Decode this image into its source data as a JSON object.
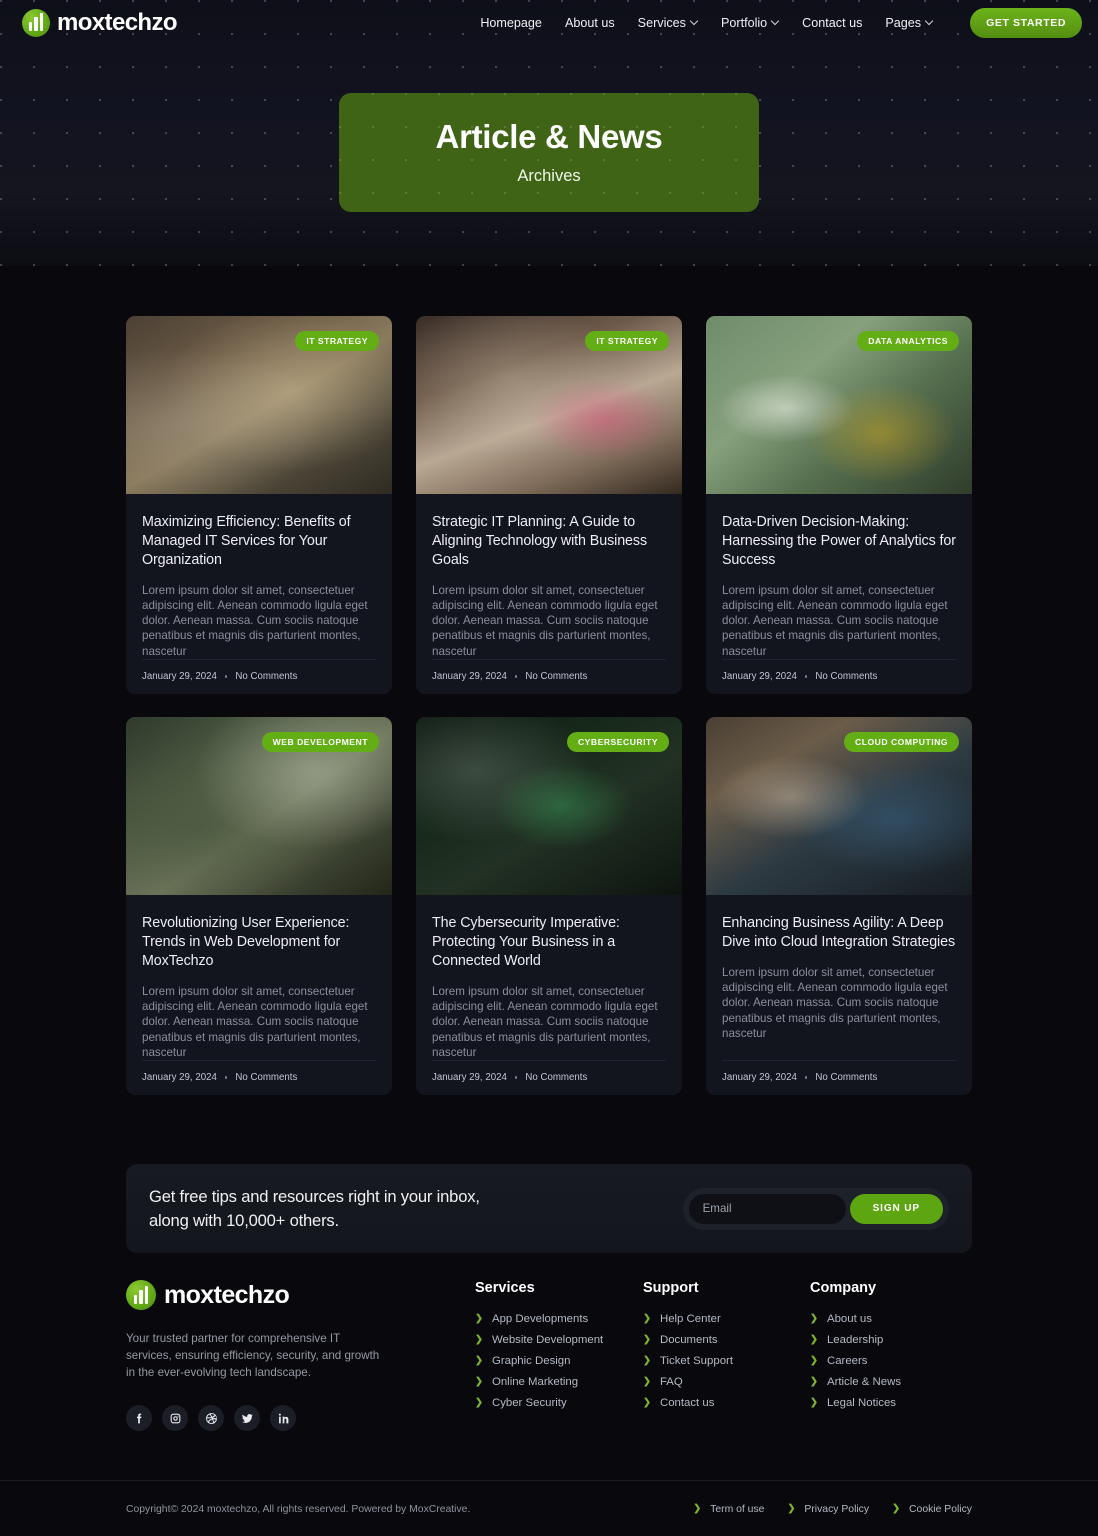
{
  "brand": {
    "name": "moxtechzo",
    "logo_icon": "bars-circle-logo-icon"
  },
  "nav": {
    "items": [
      {
        "label": "Homepage",
        "has_dropdown": false
      },
      {
        "label": "About us",
        "has_dropdown": false
      },
      {
        "label": "Services",
        "has_dropdown": true
      },
      {
        "label": "Portfolio",
        "has_dropdown": true
      },
      {
        "label": "Contact us",
        "has_dropdown": false
      },
      {
        "label": "Pages",
        "has_dropdown": true
      }
    ],
    "cta_label": "GET STARTED"
  },
  "hero": {
    "title": "Article & News",
    "subtitle": "Archives",
    "bg_color": "#3f6415"
  },
  "posts": [
    {
      "badge": "IT STRATEGY",
      "title": "Maximizing Efficiency: Benefits of Managed IT Services for Your Organization",
      "excerpt": "Lorem ipsum dolor sit amet, consectetuer adipiscing elit. Aenean commodo ligula eget dolor. Aenean massa. Cum sociis natoque penatibus et magnis dis parturient montes, nascetur",
      "date": "January 29, 2024",
      "comments": "No Comments",
      "image": "office-team-collaboration"
    },
    {
      "badge": "IT STRATEGY",
      "title": "Strategic IT Planning: A Guide to Aligning Technology with Business Goals",
      "excerpt": "Lorem ipsum dolor sit amet, consectetuer adipiscing elit. Aenean commodo ligula eget dolor. Aenean massa. Cum sociis natoque penatibus et magnis dis parturient montes, nascetur",
      "date": "January 29, 2024",
      "comments": "No Comments",
      "image": "hands-planning-sticky-notes"
    },
    {
      "badge": "DATA ANALYTICS",
      "title": "Data-Driven Decision-Making: Harnessing the Power of Analytics for Success",
      "excerpt": "Lorem ipsum dolor sit amet, consectetuer adipiscing elit. Aenean commodo ligula eget dolor. Aenean massa. Cum sociis natoque penatibus et magnis dis parturient montes, nascetur",
      "date": "January 29, 2024",
      "comments": "No Comments",
      "image": "woman-at-desktop-analytics"
    },
    {
      "badge": "WEB DEVELOPMENT",
      "title": "Revolutionizing User Experience: Trends in Web Development for MoxTechzo",
      "excerpt": "Lorem ipsum dolor sit amet, consectetuer adipiscing elit. Aenean commodo ligula eget dolor. Aenean massa. Cum sociis natoque penatibus et magnis dis parturient montes, nascetur",
      "date": "January 29, 2024",
      "comments": "No Comments",
      "image": "developer-at-workstation"
    },
    {
      "badge": "CYBERSECURITY",
      "title": "The Cybersecurity Imperative: Protecting Your Business in a Connected World",
      "excerpt": "Lorem ipsum dolor sit amet, consectetuer adipiscing elit. Aenean commodo ligula eget dolor. Aenean massa. Cum sociis natoque penatibus et magnis dis parturient montes, nascetur",
      "date": "January 29, 2024",
      "comments": "No Comments",
      "image": "phone-code-screen"
    },
    {
      "badge": "CLOUD COMPUTING",
      "title": "Enhancing Business Agility: A Deep Dive into Cloud Integration Strategies",
      "excerpt": "Lorem ipsum dolor sit amet, consectetuer adipiscing elit. Aenean commodo ligula eget dolor. Aenean massa. Cum sociis natoque penatibus et magnis dis parturient montes, nascetur",
      "date": "January 29, 2024",
      "comments": "No Comments",
      "image": "woman-coding-dual-monitor"
    }
  ],
  "newsletter": {
    "line1": "Get free tips and resources right in your inbox,",
    "line2": "along with 10,000+ others.",
    "input_placeholder": "Email",
    "input_value": "",
    "button_label": "SIGN UP"
  },
  "footer": {
    "description": "Your trusted partner for comprehensive IT services, ensuring efficiency, security, and growth in the ever-evolving tech landscape.",
    "socials": [
      {
        "name": "facebook-icon"
      },
      {
        "name": "instagram-icon"
      },
      {
        "name": "dribbble-icon"
      },
      {
        "name": "twitter-icon"
      },
      {
        "name": "linkedin-icon"
      }
    ],
    "columns": [
      {
        "heading": "Services",
        "links": [
          "App Developments",
          "Website Development",
          "Graphic Design",
          "Online Marketing",
          "Cyber Security"
        ]
      },
      {
        "heading": "Support",
        "links": [
          "Help Center",
          "Documents",
          "Ticket Support",
          "FAQ",
          "Contact us"
        ]
      },
      {
        "heading": "Company",
        "links": [
          "About us",
          "Leadership",
          "Careers",
          "Article & News",
          "Legal Notices"
        ]
      }
    ],
    "copyright": "Copyright© 2024 moxtechzo, All rights reserved. Powered by MoxCreative.",
    "legal_links": [
      "Term of use",
      "Privacy Policy",
      "Cookie Policy"
    ]
  },
  "colors": {
    "accent_green": "#63ad15",
    "hero_green": "#3f6415",
    "page_bg": "#08080d",
    "card_bg": "#12141e"
  }
}
